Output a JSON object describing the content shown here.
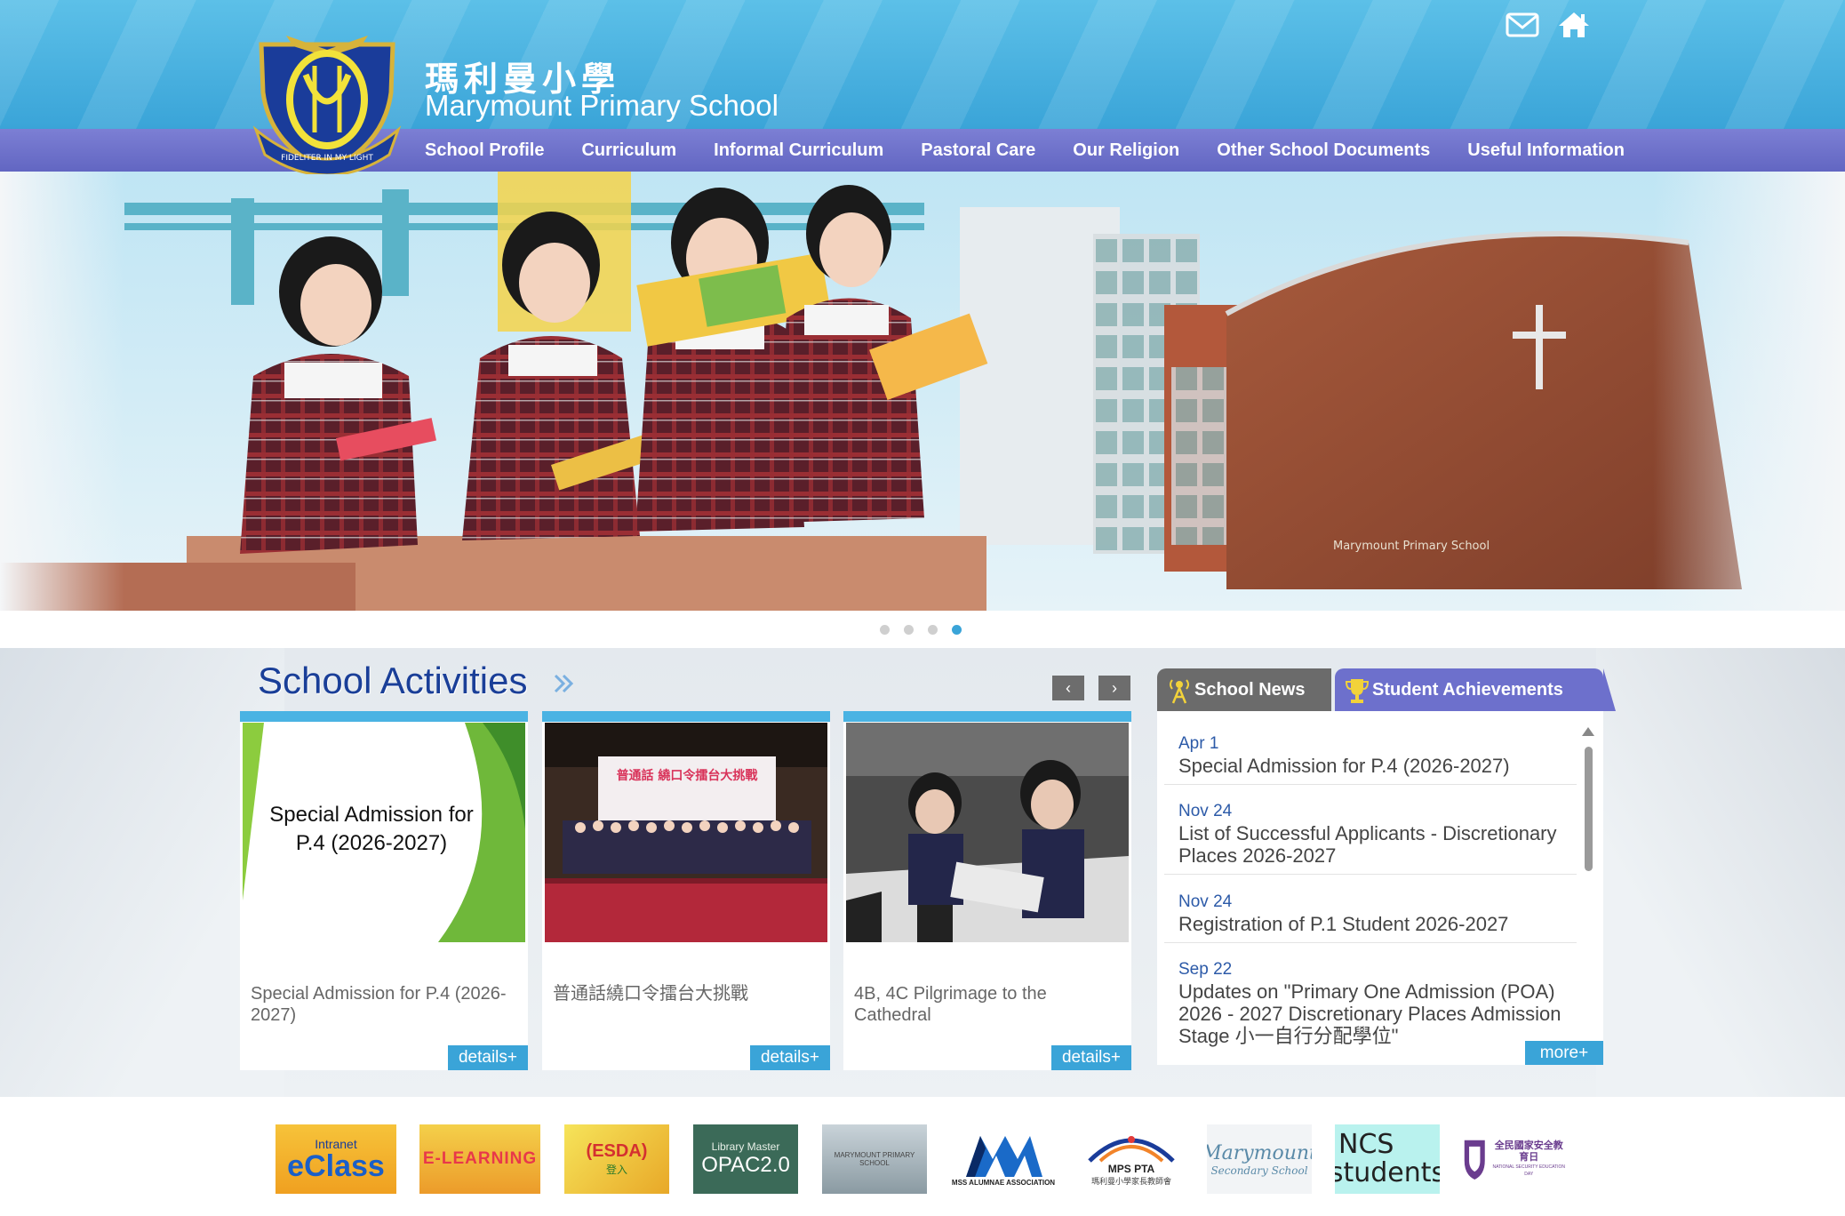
{
  "header": {
    "school_name_zh": "瑪利曼小學",
    "school_name_en": "Marymount Primary School",
    "crest_motto": "FIDELITER IN MY LIGHT"
  },
  "top_icons": [
    "mail-icon",
    "home-icon"
  ],
  "nav": {
    "items": [
      "School Profile",
      "Curriculum",
      "Informal Curriculum",
      "Pastoral Care",
      "Our Religion",
      "Other School Documents",
      "Useful Information"
    ]
  },
  "hero": {
    "slides": 4,
    "active_slide": 4,
    "building_sign": "Marymount Primary School"
  },
  "activities": {
    "title": "School Activities",
    "prev_label": "‹",
    "next_label": "›",
    "cards": [
      {
        "image_text": "Special Admission for P.4 (2026-2027)",
        "caption": "Special Admission for P.4 (2026-2027)",
        "details_label": "details+"
      },
      {
        "image_text": "普通話 繞口令擂台大挑戰",
        "caption": "普通話繞口令擂台大挑戰",
        "details_label": "details+"
      },
      {
        "image_text": "",
        "caption": "4B, 4C Pilgrimage to the Cathedral",
        "details_label": "details+"
      }
    ]
  },
  "news": {
    "tabs": [
      "School News",
      "Student Achievements"
    ],
    "items": [
      {
        "date": "Apr 1",
        "title": "Special Admission for P.4 (2026-2027)"
      },
      {
        "date": "Nov 24",
        "title": "List of Successful Applicants - Discretionary Places 2026-2027"
      },
      {
        "date": "Nov 24",
        "title": "Registration of P.1 Student 2026-2027"
      },
      {
        "date": "Sep 22",
        "title": "Updates on \"Primary One Admission (POA) 2026 - 2027 Discretionary Places Admission Stage 小一自行分配學位\""
      }
    ],
    "more_label": "more+"
  },
  "footer_logos": [
    {
      "line1": "Intranet",
      "line2": "eClass"
    },
    {
      "line1": "E-LEARNING",
      "line2": ""
    },
    {
      "line1": "(ESDA)",
      "line2": "登入"
    },
    {
      "line1": "Library Master",
      "line2": "OPAC2.0"
    },
    {
      "line1": "MARYMOUNT PRIMARY SCHOOL",
      "line2": ""
    },
    {
      "line1": "MSS ALUMNAE ASSOCIATION",
      "line2": ""
    },
    {
      "line1": "MPS PTA",
      "line2": "瑪利曼小學家長教師會"
    },
    {
      "line1": "Marymount",
      "line2": "Secondary School"
    },
    {
      "line1": "NCS",
      "line2": "students"
    },
    {
      "line1": "全民國家安全教育日",
      "line2": "NATIONAL SECURITY EDUCATION DAY"
    }
  ],
  "colors": {
    "header_blue": "#4cb2e2",
    "nav_purple": "#6a6dc8",
    "title_blue": "#1a3f98",
    "accent_blue": "#3aa4d8",
    "tab_grey": "#6b6b6b"
  }
}
